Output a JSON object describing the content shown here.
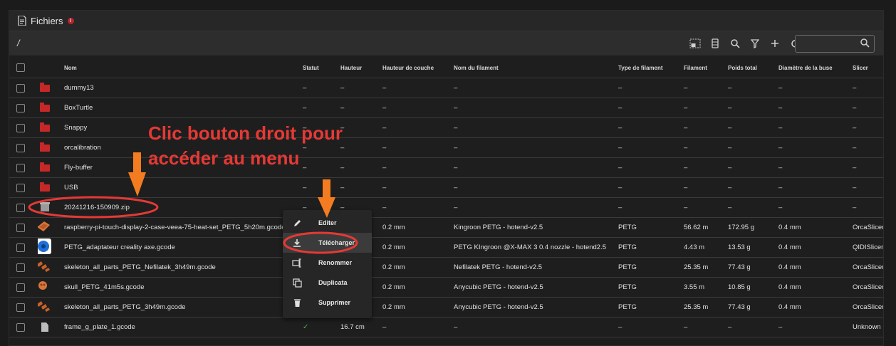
{
  "panel": {
    "title": "Fichiers",
    "badge": "!"
  },
  "toolbar": {
    "path": "/",
    "search_placeholder": "",
    "tools": [
      "upload-icon",
      "columns-icon",
      "search-icon",
      "filter-icon",
      "plus-icon",
      "refresh-icon"
    ]
  },
  "table": {
    "headers": [
      "Nom",
      "Statut",
      "Hauteur",
      "Hauteur de couche",
      "Nom du filament",
      "Type de filament",
      "Filament",
      "Poids total",
      "Diamètre de la buse",
      "Slicer"
    ],
    "rows": [
      {
        "kind": "folder",
        "name": "dummy13",
        "status": "–",
        "height": "–",
        "layer": "–",
        "filament_name": "–",
        "filament_type": "–",
        "filament": "–",
        "weight": "–",
        "nozzle": "–",
        "slicer": "–"
      },
      {
        "kind": "folder",
        "name": "BoxTurtle",
        "status": "–",
        "height": "–",
        "layer": "–",
        "filament_name": "–",
        "filament_type": "–",
        "filament": "–",
        "weight": "–",
        "nozzle": "–",
        "slicer": "–"
      },
      {
        "kind": "folder",
        "name": "Snappy",
        "status": "–",
        "height": "–",
        "layer": "–",
        "filament_name": "–",
        "filament_type": "–",
        "filament": "–",
        "weight": "–",
        "nozzle": "–",
        "slicer": "–"
      },
      {
        "kind": "folder",
        "name": "orcalibration",
        "status": "–",
        "height": "–",
        "layer": "–",
        "filament_name": "–",
        "filament_type": "–",
        "filament": "–",
        "weight": "–",
        "nozzle": "–",
        "slicer": "–"
      },
      {
        "kind": "folder",
        "name": "Fly-buffer",
        "status": "–",
        "height": "–",
        "layer": "–",
        "filament_name": "–",
        "filament_type": "–",
        "filament": "–",
        "weight": "–",
        "nozzle": "–",
        "slicer": "–"
      },
      {
        "kind": "folder",
        "name": "USB",
        "status": "–",
        "height": "–",
        "layer": "–",
        "filament_name": "–",
        "filament_type": "–",
        "filament": "–",
        "weight": "–",
        "nozzle": "–",
        "slicer": "–"
      },
      {
        "kind": "zip",
        "name": "20241216-150909.zip",
        "status": "–",
        "height": "–",
        "layer": "–",
        "filament_name": "–",
        "filament_type": "–",
        "filament": "–",
        "weight": "–",
        "nozzle": "–",
        "slicer": "–"
      },
      {
        "kind": "thumb-orange",
        "name": "raspberry-pi-touch-display-2-case-veea-75-heat-set_PETG_5h20m.gcode",
        "status": "",
        "height": "",
        "layer": "0.2 mm",
        "filament_name": "Kingroon PETG - hotend-v2.5",
        "filament_type": "PETG",
        "filament": "56.62 m",
        "weight": "172.95 g",
        "nozzle": "0.4 mm",
        "slicer": "OrcaSlicer"
      },
      {
        "kind": "thumb-blue",
        "name": "PETG_adaptateur creality axe.gcode",
        "status": "",
        "height": "",
        "layer": "0.2 mm",
        "filament_name": "PETG KIngroon @X-MAX 3 0.4 nozzle - hotend2.5",
        "filament_type": "PETG",
        "filament": "4.43 m",
        "weight": "13.53 g",
        "nozzle": "0.4 mm",
        "slicer": "QIDISlicer"
      },
      {
        "kind": "thumb-parts",
        "name": "skeleton_all_parts_PETG_Nefilatek_3h49m.gcode",
        "status": "",
        "height": "",
        "layer": "0.2 mm",
        "filament_name": "Nefilatek PETG - hotend-v2.5",
        "filament_type": "PETG",
        "filament": "25.35 m",
        "weight": "77.43 g",
        "nozzle": "0.4 mm",
        "slicer": "OrcaSlicer"
      },
      {
        "kind": "thumb-skull",
        "name": "skull_PETG_41m5s.gcode",
        "status": "",
        "height": "",
        "layer": "0.2 mm",
        "filament_name": "Anycubic PETG - hotend-v2.5",
        "filament_type": "PETG",
        "filament": "3.55 m",
        "weight": "10.85 g",
        "nozzle": "0.4 mm",
        "slicer": "OrcaSlicer"
      },
      {
        "kind": "thumb-parts",
        "name": "skeleton_all_parts_PETG_3h49m.gcode",
        "status": "",
        "height": "",
        "layer": "0.2 mm",
        "filament_name": "Anycubic PETG - hotend-v2.5",
        "filament_type": "PETG",
        "filament": "25.35 m",
        "weight": "77.43 g",
        "nozzle": "0.4 mm",
        "slicer": "OrcaSlicer"
      },
      {
        "kind": "gcode",
        "name": "frame_g_plate_1.gcode",
        "status": "✓",
        "height": "16.7 cm",
        "layer": "–",
        "filament_name": "–",
        "filament_type": "–",
        "filament": "–",
        "weight": "–",
        "nozzle": "–",
        "slicer": "Unknown"
      }
    ]
  },
  "context_menu": {
    "items": [
      "Editer",
      "Télécharger",
      "Renommer",
      "Duplicata",
      "Supprimer"
    ]
  },
  "annotation": {
    "line1": "Clic bouton droit pour",
    "line2": "accéder au menu",
    "color": "#e53935",
    "arrow_color": "#f47c20"
  }
}
